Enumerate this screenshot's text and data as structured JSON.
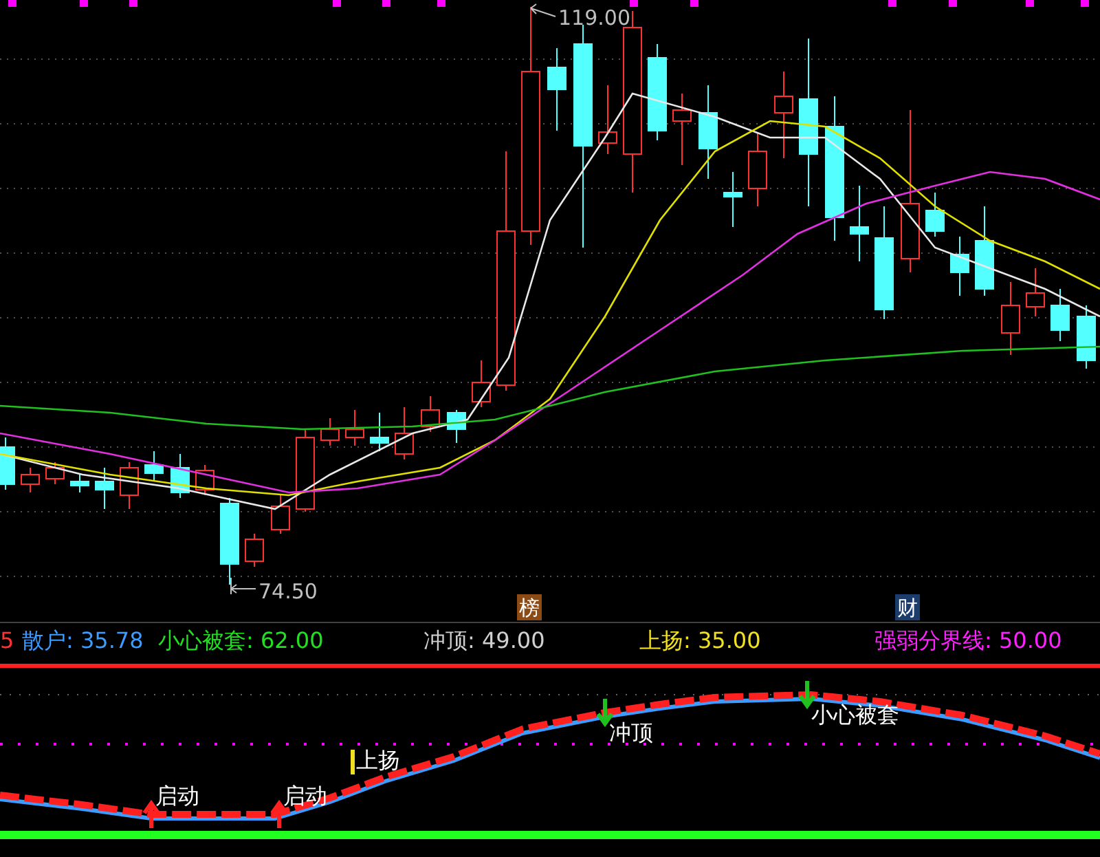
{
  "price_chart": {
    "high_label": "119.00",
    "low_label": "74.50",
    "markers": [
      {
        "text": "榜",
        "color": "#8c4a14"
      },
      {
        "text": "财",
        "color": "#1c3c6c"
      }
    ]
  },
  "legend": [
    {
      "text": "5",
      "color": "#ff3232"
    },
    {
      "text": "散户: 35.78",
      "color": "#3c9cff"
    },
    {
      "text": "小心被套: 62.00",
      "color": "#20e020"
    },
    {
      "text": "冲顶: 49.00",
      "color": "#d0d0d0"
    },
    {
      "text": "上扬: 35.00",
      "color": "#f0e020"
    },
    {
      "text": "强弱分界线: 50.00",
      "color": "#ff20ff"
    }
  ],
  "indicator": {
    "signals": [
      {
        "kind": "up",
        "text": "启动"
      },
      {
        "kind": "up",
        "text": "启动"
      },
      {
        "kind": "bar",
        "text": "上扬"
      },
      {
        "kind": "down",
        "text": "冲顶"
      },
      {
        "kind": "down",
        "text": "小心被套"
      }
    ]
  }
}
